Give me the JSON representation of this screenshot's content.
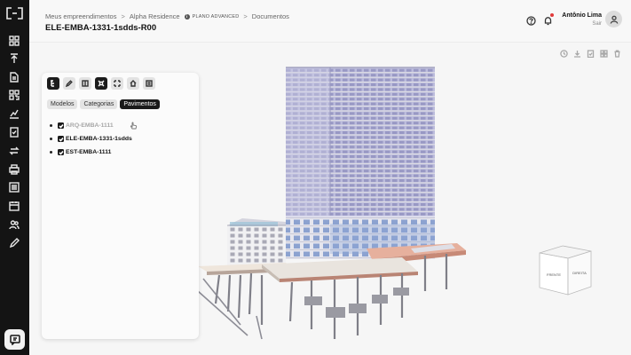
{
  "breadcrumb": {
    "items": [
      "Meus empreendimentos",
      "Alpha Residence"
    ],
    "plan_badge": "PLANO ADVANCED",
    "current": "Documentos",
    "separator": ">"
  },
  "page": {
    "title": "ELE-EMBA-1331-1sdds-R00"
  },
  "user": {
    "name": "Antônio Lima",
    "logout_label": "Sair"
  },
  "panel": {
    "tabs": [
      {
        "label": "Modelos",
        "active": false
      },
      {
        "label": "Categorias",
        "active": false
      },
      {
        "label": "Pavimentos",
        "active": true
      }
    ],
    "tools": [
      "tree-icon",
      "pencil-icon",
      "split-icon",
      "explode-icon",
      "section-icon",
      "home-icon",
      "list-icon"
    ],
    "active_tools": [
      "tree-icon",
      "explode-icon"
    ],
    "models": [
      {
        "label": "ARQ-EMBA-1111",
        "checked": true,
        "muted": true
      },
      {
        "label": "ELE-EMBA-1331-1sdds",
        "checked": true,
        "muted": false
      },
      {
        "label": "EST-EMBA-1111",
        "checked": true,
        "muted": false
      }
    ]
  },
  "viewcube": {
    "face_front": "FRENTE",
    "face_side": "DIREITA"
  },
  "colors": {
    "rail": "#141414",
    "accent": "#1a1a1a",
    "tower_facade": "#b9b9d9",
    "glass": "#8fa3cf",
    "slab": "#e7b2a0"
  }
}
